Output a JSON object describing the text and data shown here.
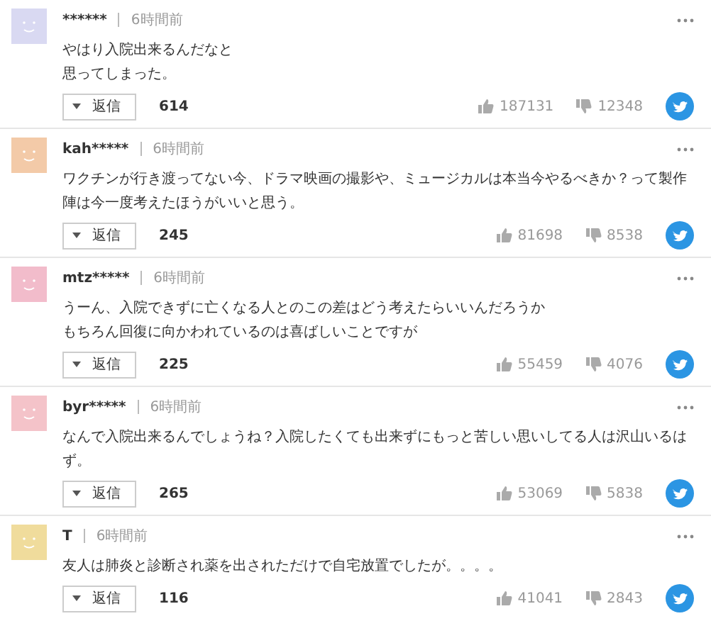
{
  "comments": [
    {
      "user": "******",
      "time": "6時間前",
      "color": "#d9d9f2",
      "text": [
        "やはり入院出来るんだなと",
        "思ってしまった。"
      ],
      "reply_label": "返信",
      "reply_count": "614",
      "likes": "187131",
      "dislikes": "12348"
    },
    {
      "user": "kah*****",
      "time": "6時間前",
      "color": "#f3caa8",
      "text": [
        "ワクチンが行き渡ってない今、ドラマ映画の撮影や、ミュージカルは本当今やるべきか？って製作陣は今一度考えたほうがいいと思う。"
      ],
      "reply_label": "返信",
      "reply_count": "245",
      "likes": "81698",
      "dislikes": "8538"
    },
    {
      "user": "mtz*****",
      "time": "6時間前",
      "color": "#f2bccb",
      "text": [
        "うーん、入院できずに亡くなる人とのこの差はどう考えたらいいんだろうか",
        "もちろん回復に向かわれているのは喜ばしいことですが"
      ],
      "reply_label": "返信",
      "reply_count": "225",
      "likes": "55459",
      "dislikes": "4076"
    },
    {
      "user": "byr*****",
      "time": "6時間前",
      "color": "#f4c3c9",
      "text": [
        "なんで入院出来るんでしょうね？入院したくても出来ずにもっと苦しい思いしてる人は沢山いるはず。"
      ],
      "reply_label": "返信",
      "reply_count": "265",
      "likes": "53069",
      "dislikes": "5838"
    },
    {
      "user": "T",
      "time": "6時間前",
      "color": "#f0dc9c",
      "text": [
        "友人は肺炎と診断され薬を出されただけで自宅放置でしたが。。。。"
      ],
      "reply_label": "返信",
      "reply_count": "116",
      "likes": "41041",
      "dislikes": "2843"
    }
  ]
}
